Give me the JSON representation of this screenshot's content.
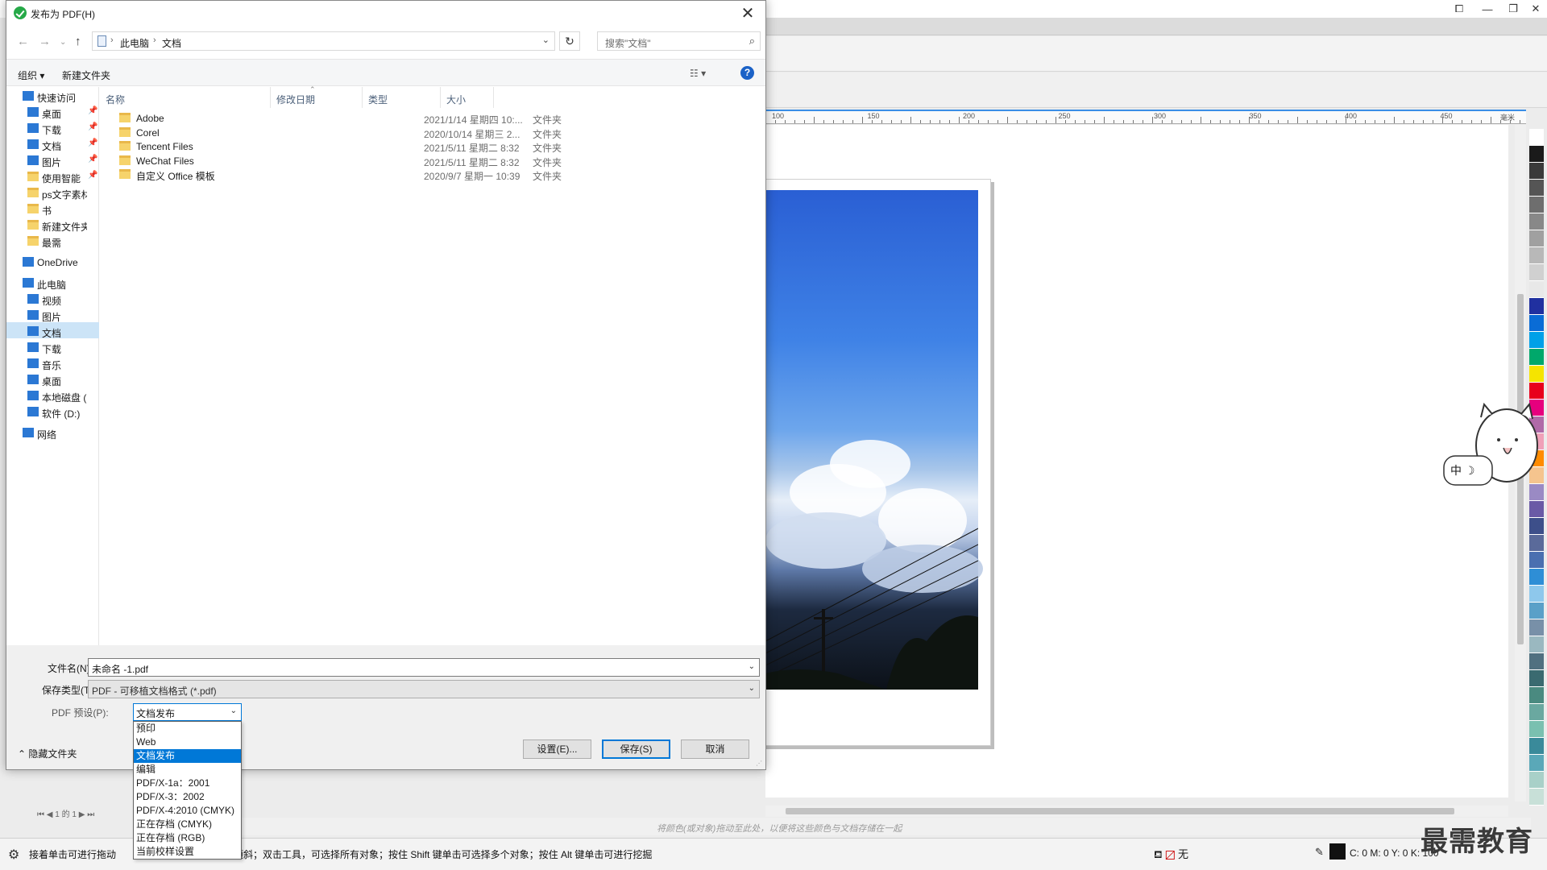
{
  "dialog": {
    "title": "发布为 PDF(H)",
    "breadcrumb": [
      "此电脑",
      "文档"
    ],
    "search_placeholder": "搜索\"文档\"",
    "toolbar": {
      "organize": "组织 ▾",
      "new_folder": "新建文件夹"
    },
    "nav_quick_access": "快速访问",
    "nav_items": [
      {
        "label": "桌面",
        "icon": "desktop-icon",
        "pinned": true
      },
      {
        "label": "下载",
        "icon": "download-icon",
        "pinned": true
      },
      {
        "label": "文档",
        "icon": "document-icon",
        "pinned": true
      },
      {
        "label": "图片",
        "icon": "picture-icon",
        "pinned": true
      },
      {
        "label": "使用智能",
        "icon": "folder-icon",
        "pinned": true
      },
      {
        "label": "ps文字素材",
        "icon": "folder-icon",
        "pinned": false
      },
      {
        "label": "书",
        "icon": "folder-icon",
        "pinned": false
      },
      {
        "label": "新建文件夹",
        "icon": "folder-icon",
        "pinned": false
      },
      {
        "label": "最需",
        "icon": "folder-icon",
        "pinned": false
      }
    ],
    "nav_onedrive": "OneDrive",
    "nav_this_pc": "此电脑",
    "nav_pc_items": [
      {
        "label": "视频",
        "icon": "video-icon"
      },
      {
        "label": "图片",
        "icon": "picture-icon"
      },
      {
        "label": "文档",
        "icon": "document-icon",
        "selected": true
      },
      {
        "label": "下载",
        "icon": "download-icon"
      },
      {
        "label": "音乐",
        "icon": "music-icon"
      },
      {
        "label": "桌面",
        "icon": "desktop-icon"
      },
      {
        "label": "本地磁盘 (C:)",
        "icon": "drive-icon"
      },
      {
        "label": "软件 (D:)",
        "icon": "drive-icon"
      }
    ],
    "nav_network": "网络",
    "columns": [
      "名称",
      "修改日期",
      "类型",
      "大小"
    ],
    "files": [
      {
        "name": "Adobe",
        "date": "2021/1/14 星期四 10:...",
        "type": "文件夹"
      },
      {
        "name": "Corel",
        "date": "2020/10/14 星期三 2...",
        "type": "文件夹"
      },
      {
        "name": "Tencent Files",
        "date": "2021/5/11 星期二 8:32",
        "type": "文件夹"
      },
      {
        "name": "WeChat Files",
        "date": "2021/5/11 星期二 8:32",
        "type": "文件夹"
      },
      {
        "name": "自定义 Office 模板",
        "date": "2020/9/7 星期一 10:39",
        "type": "文件夹"
      }
    ],
    "filename_label": "文件名(N):",
    "filename_value": "未命名 -1.pdf",
    "savetype_label": "保存类型(T):",
    "savetype_value": "PDF - 可移植文档格式 (*.pdf)",
    "preset_label": "PDF 预设(P):",
    "preset_value": "文档发布",
    "preset_options": [
      "预印",
      "Web",
      "文档发布",
      "编辑",
      "PDF/X-1a：2001",
      "PDF/X-3：2002",
      "PDF/X-4:2010 (CMYK)",
      "正在存档 (CMYK)",
      "正在存档 (RGB)",
      "当前校样设置"
    ],
    "preset_selected_index": 2,
    "hide_folders": "隐藏文件夹",
    "settings_button": "设置(E)...",
    "save_button": "保存(S)",
    "cancel_button": "取消"
  },
  "app": {
    "ruler_labels": [
      "100",
      "150",
      "200",
      "250",
      "300",
      "350",
      "400",
      "450",
      "毫米"
    ],
    "palette_colors": [
      "#ffffff",
      "#1a1a1a",
      "#3a3a3a",
      "#555555",
      "#6e6e6e",
      "#888888",
      "#a0a0a0",
      "#b8b8b8",
      "#d0d0d0",
      "#e8e8e8",
      "#2030a0",
      "#0a6cd6",
      "#00a0e8",
      "#00a86b",
      "#f5e400",
      "#e8001c",
      "#e6007e",
      "#b06aa8",
      "#f0a0b8",
      "#ff8c00",
      "#f5c48e",
      "#9a8ac4",
      "#6a5aa6",
      "#3d4f8a",
      "#5a6a9a",
      "#4a6fb0",
      "#2e8ed6",
      "#8ec8ec",
      "#5aa0c8",
      "#7890a8",
      "#9ab8c0",
      "#507080",
      "#3a6a70",
      "#4a8a80",
      "#6aa8a0",
      "#7ac0b0",
      "#3a8a9a",
      "#5aa8b8",
      "#a8d0c8",
      "#c8e0d8"
    ],
    "drag_hint": "将颜色(或对象)拖动至此处，以便将这些颜色与文档存储在一起",
    "status_left": "接着单击可进行拖动",
    "status_right": "倾斜；双击工具，可选择所有对象；按住 Shift 键单击可选择多个对象；按住 Alt 键单击可进行挖掘",
    "fill_label": "无",
    "cmyk": "C: 0 M: 0 Y: 0 K: 100",
    "page_tabs": "1 的 1",
    "mascot_text": "中 ☽",
    "watermark": "最需教育"
  }
}
